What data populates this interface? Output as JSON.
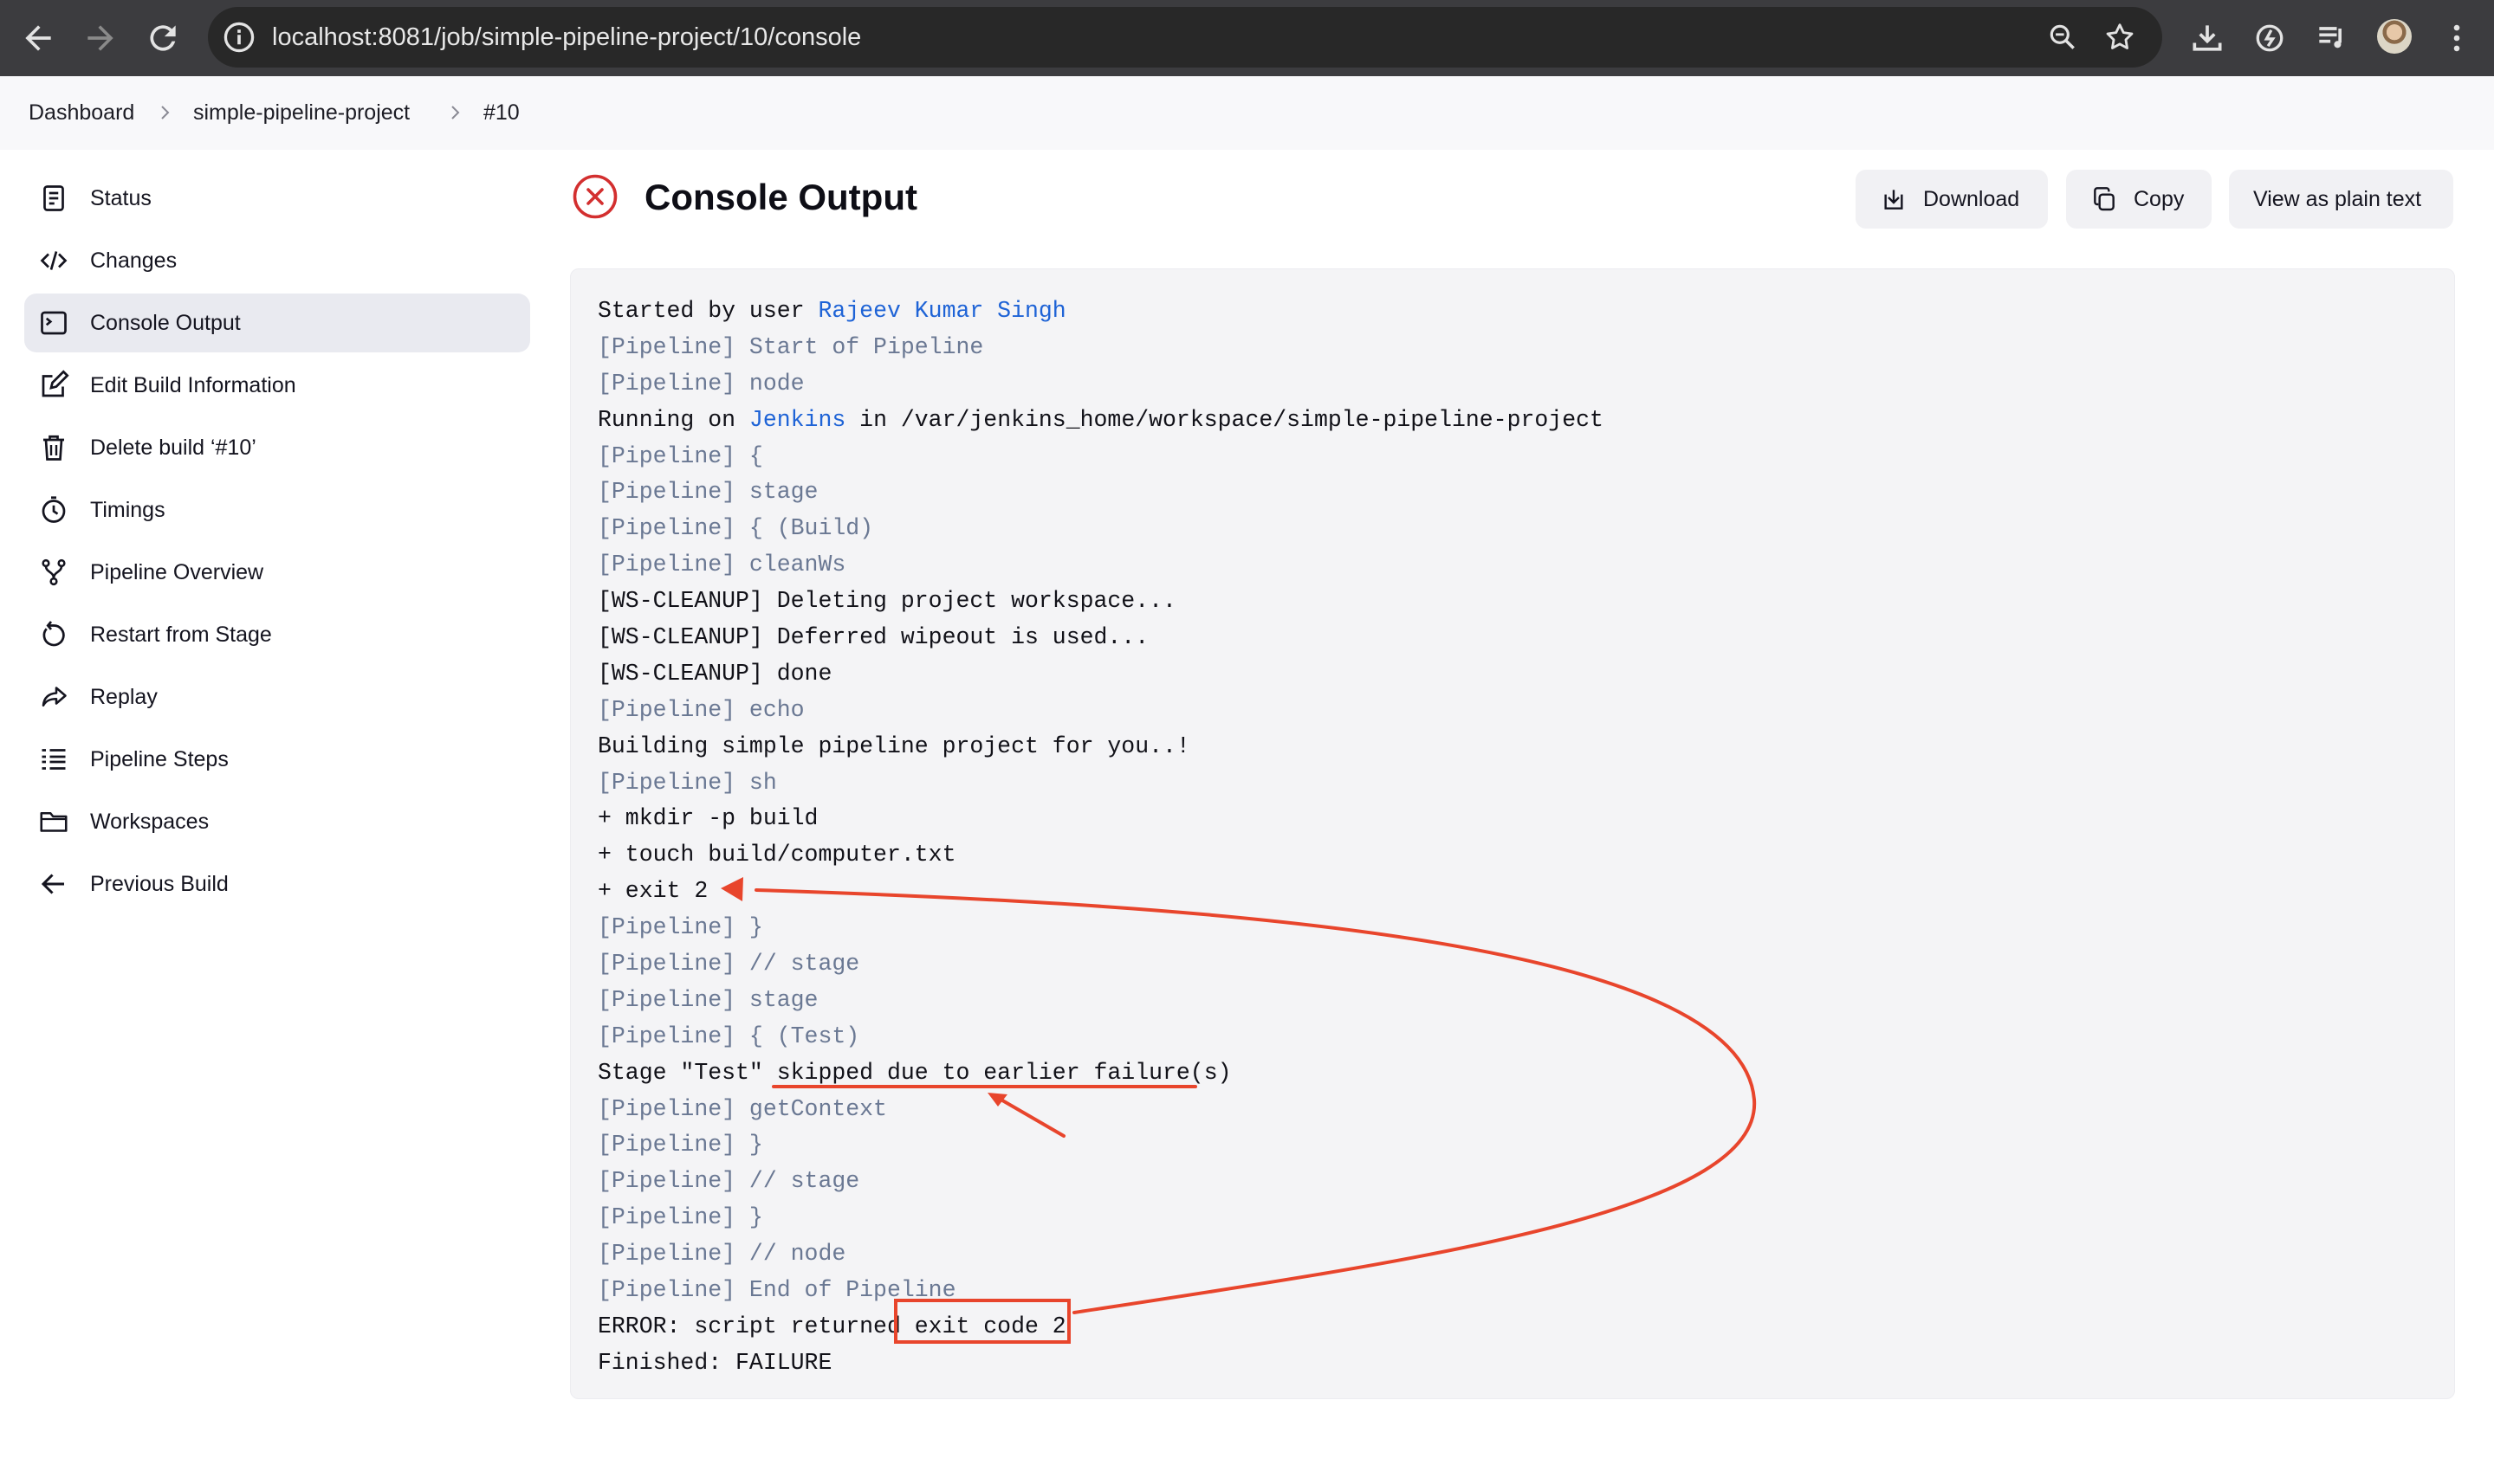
{
  "browser": {
    "url": "localhost:8081/job/simple-pipeline-project/10/console",
    "icons": [
      "back-arrow-icon",
      "forward-arrow-icon",
      "reload-icon",
      "site-info-icon",
      "zoom-icon",
      "bookmark-star-icon",
      "download-icon",
      "extension-icon",
      "media-icon",
      "profile-avatar",
      "more-menu-icon"
    ]
  },
  "breadcrumb": {
    "items": [
      "Dashboard",
      "simple-pipeline-project",
      "#10"
    ]
  },
  "sidebar": {
    "items": [
      {
        "label": "Status",
        "icon": "document-icon"
      },
      {
        "label": "Changes",
        "icon": "code-icon"
      },
      {
        "label": "Console Output",
        "icon": "terminal-icon",
        "active": true
      },
      {
        "label": "Edit Build Information",
        "icon": "edit-icon"
      },
      {
        "label": "Delete build ‘#10’",
        "icon": "trash-icon"
      },
      {
        "label": "Timings",
        "icon": "stopwatch-icon"
      },
      {
        "label": "Pipeline Overview",
        "icon": "branch-icon"
      },
      {
        "label": "Restart from Stage",
        "icon": "restart-icon"
      },
      {
        "label": "Replay",
        "icon": "replay-icon"
      },
      {
        "label": "Pipeline Steps",
        "icon": "list-icon"
      },
      {
        "label": "Workspaces",
        "icon": "folder-icon"
      },
      {
        "label": "Previous Build",
        "icon": "arrow-left-icon"
      }
    ]
  },
  "header": {
    "title": "Console Output",
    "status_icon": "failure-x-icon",
    "buttons": {
      "download": "Download",
      "copy": "Copy",
      "plain_text": "View as plain text"
    }
  },
  "colors": {
    "failure": "#d32f2f",
    "link": "#1e63d6",
    "pipeline_text": "#6a7893",
    "annotation": "#e8452c"
  },
  "console": {
    "lines": [
      {
        "parts": [
          {
            "t": "Started by user "
          },
          {
            "t": "Rajeev Kumar Singh",
            "link": true
          }
        ]
      },
      {
        "pipeline": true,
        "parts": [
          {
            "t": "[Pipeline] Start of Pipeline"
          }
        ]
      },
      {
        "pipeline": true,
        "parts": [
          {
            "t": "[Pipeline] node"
          }
        ]
      },
      {
        "parts": [
          {
            "t": "Running on "
          },
          {
            "t": "Jenkins",
            "link": true
          },
          {
            "t": " in /var/jenkins_home/workspace/simple-pipeline-project"
          }
        ]
      },
      {
        "pipeline": true,
        "parts": [
          {
            "t": "[Pipeline] {"
          }
        ]
      },
      {
        "pipeline": true,
        "parts": [
          {
            "t": "[Pipeline] stage"
          }
        ]
      },
      {
        "pipeline": true,
        "parts": [
          {
            "t": "[Pipeline] { (Build)"
          }
        ]
      },
      {
        "pipeline": true,
        "parts": [
          {
            "t": "[Pipeline] cleanWs"
          }
        ]
      },
      {
        "parts": [
          {
            "t": "[WS-CLEANUP] Deleting project workspace..."
          }
        ]
      },
      {
        "parts": [
          {
            "t": "[WS-CLEANUP] Deferred wipeout is used..."
          }
        ]
      },
      {
        "parts": [
          {
            "t": "[WS-CLEANUP] done"
          }
        ]
      },
      {
        "pipeline": true,
        "parts": [
          {
            "t": "[Pipeline] echo"
          }
        ]
      },
      {
        "parts": [
          {
            "t": "Building simple pipeline project for you..!"
          }
        ]
      },
      {
        "pipeline": true,
        "parts": [
          {
            "t": "[Pipeline] sh"
          }
        ]
      },
      {
        "parts": [
          {
            "t": "+ mkdir -p build"
          }
        ]
      },
      {
        "parts": [
          {
            "t": "+ touch build/computer.txt"
          }
        ]
      },
      {
        "parts": [
          {
            "t": "+ exit 2"
          }
        ]
      },
      {
        "pipeline": true,
        "parts": [
          {
            "t": "[Pipeline] }"
          }
        ]
      },
      {
        "pipeline": true,
        "parts": [
          {
            "t": "[Pipeline] // stage"
          }
        ]
      },
      {
        "pipeline": true,
        "parts": [
          {
            "t": "[Pipeline] stage"
          }
        ]
      },
      {
        "pipeline": true,
        "parts": [
          {
            "t": "[Pipeline] { (Test)"
          }
        ]
      },
      {
        "parts": [
          {
            "t": "Stage \"Test\" skipped due to earlier failure(s)"
          }
        ]
      },
      {
        "pipeline": true,
        "parts": [
          {
            "t": "[Pipeline] getContext"
          }
        ]
      },
      {
        "pipeline": true,
        "parts": [
          {
            "t": "[Pipeline] }"
          }
        ]
      },
      {
        "pipeline": true,
        "parts": [
          {
            "t": "[Pipeline] // stage"
          }
        ]
      },
      {
        "pipeline": true,
        "parts": [
          {
            "t": "[Pipeline] }"
          }
        ]
      },
      {
        "pipeline": true,
        "parts": [
          {
            "t": "[Pipeline] // node"
          }
        ]
      },
      {
        "pipeline": true,
        "parts": [
          {
            "t": "[Pipeline] End of Pipeline"
          }
        ]
      },
      {
        "parts": [
          {
            "t": "ERROR: script returned exit code 2"
          }
        ]
      },
      {
        "parts": [
          {
            "t": "Finished: FAILURE"
          }
        ]
      }
    ]
  }
}
